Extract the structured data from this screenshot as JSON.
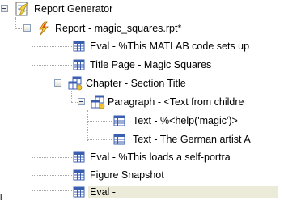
{
  "tree": {
    "root": "Report Generator",
    "report": "Report - magic_squares.rpt*",
    "items": [
      "Eval - %This MATLAB code sets up",
      "Title Page - Magic Squares",
      "Chapter - Section Title",
      "Paragraph - <Text from childre",
      "Text - %<help('magic')>",
      "Text - The German artist A",
      "Eval - %This loads a self-portra",
      "Figure Snapshot",
      "Eval -"
    ]
  },
  "selected_item": "Eval -",
  "corner_mark": "l",
  "colors": {
    "selection_bg": "#ecead9",
    "tree_lines": "#a9a9a9",
    "expander_border": "#8a9fb9"
  },
  "icons": {
    "root": "report-generator-icon",
    "report": "report-lightning-icon",
    "component": "table-grid-icon",
    "container": "multi-grid-icon"
  }
}
